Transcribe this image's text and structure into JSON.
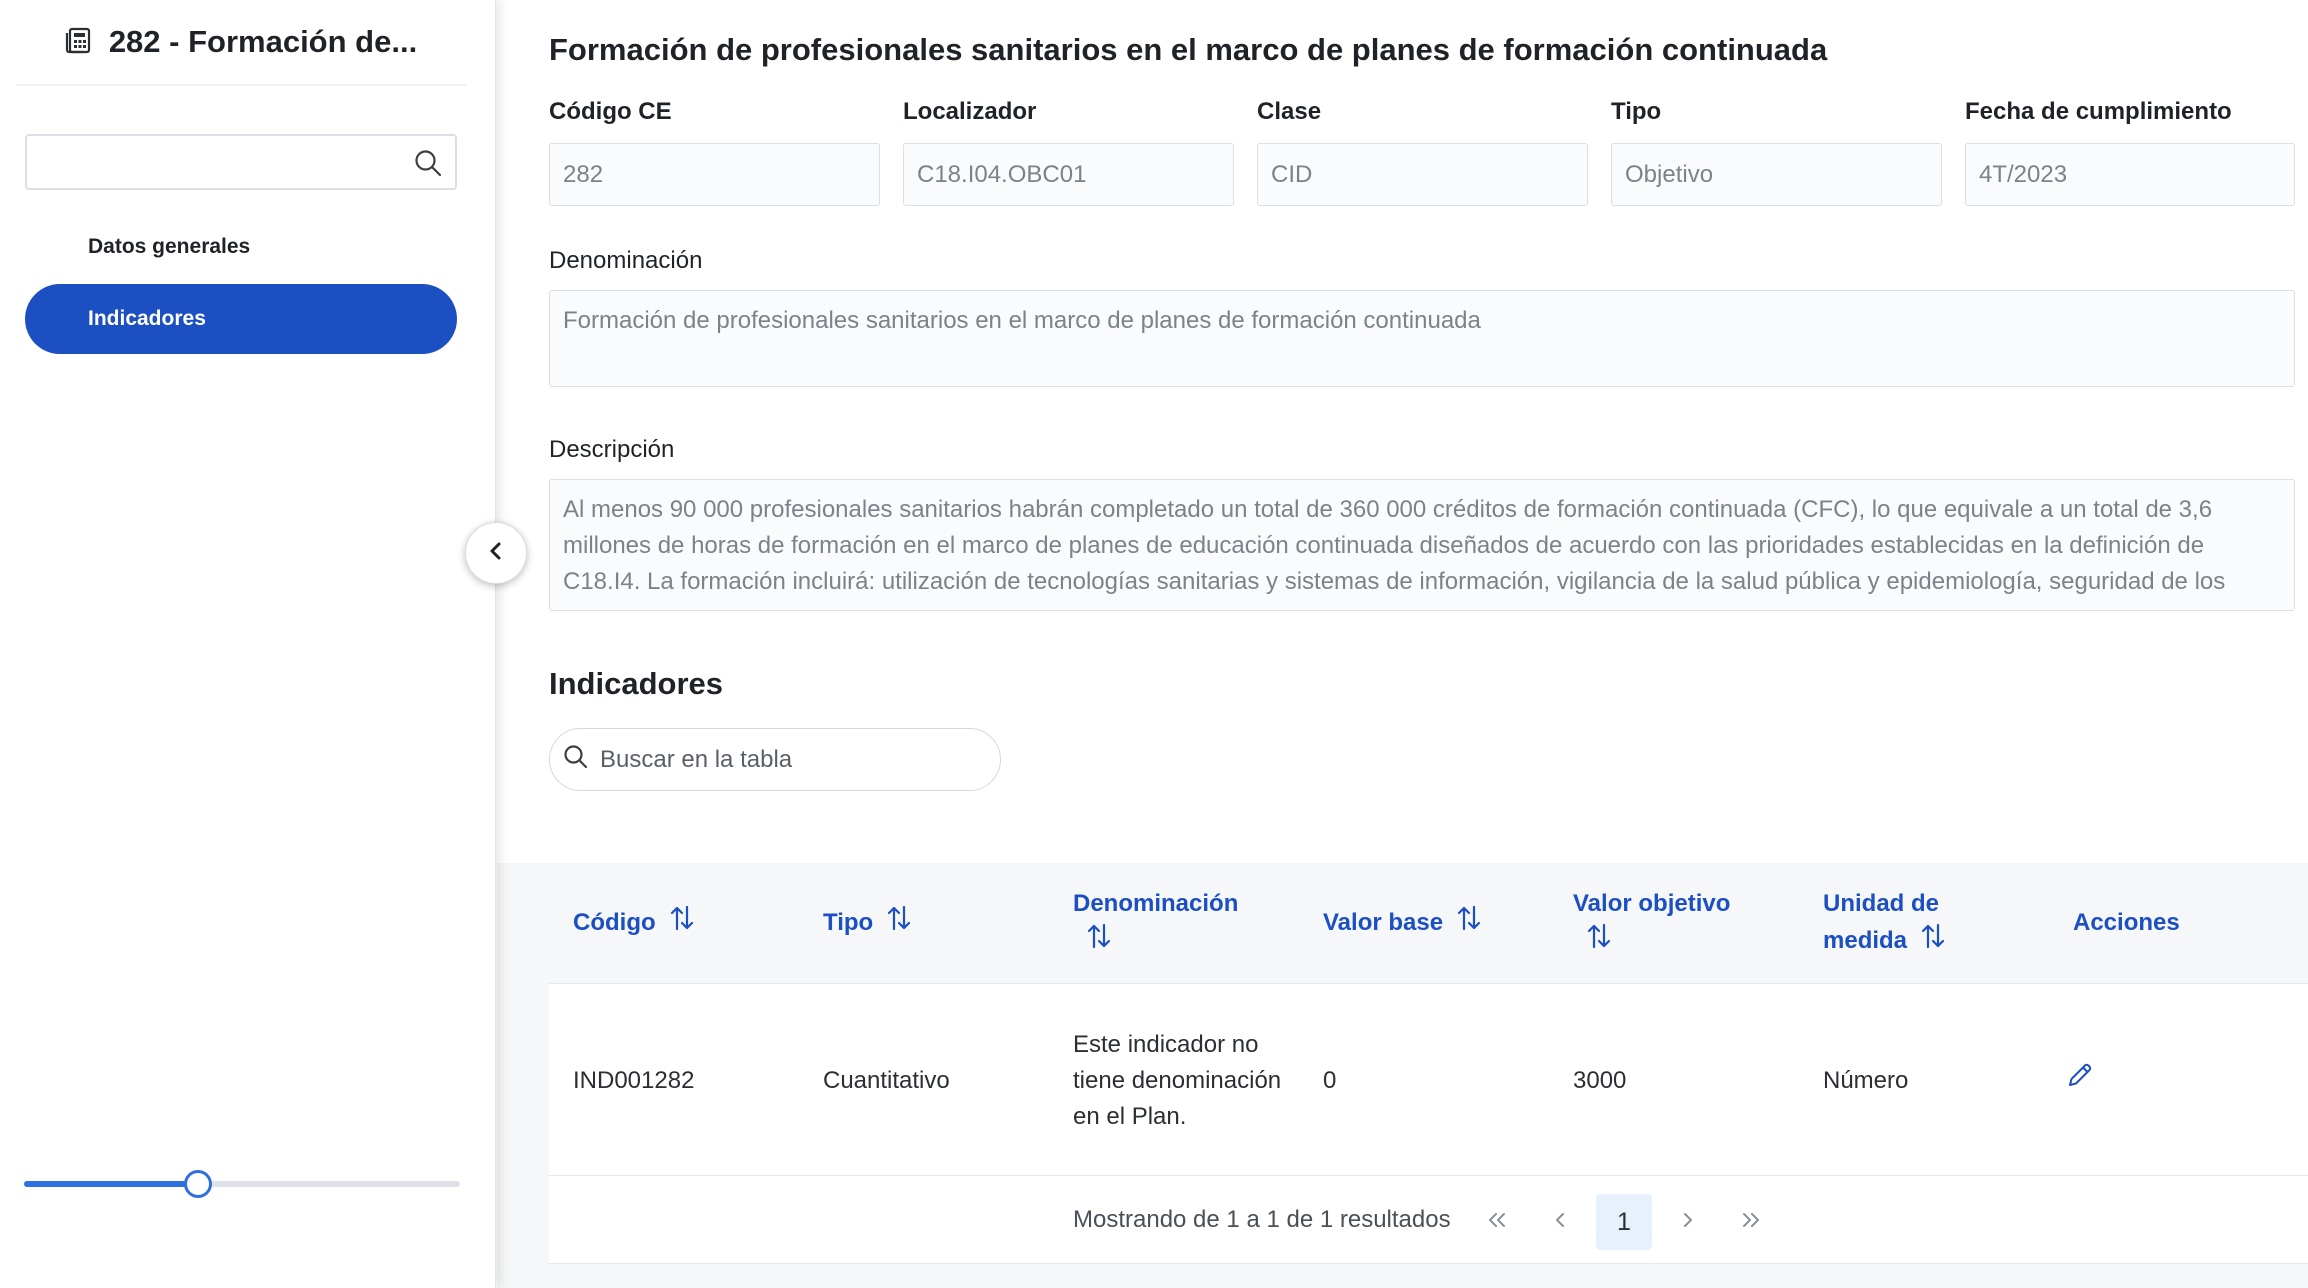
{
  "sidebar": {
    "title": "282 - Formación de...",
    "search_value": "",
    "items": [
      {
        "label": "Datos generales",
        "active": false
      },
      {
        "label": "Indicadores",
        "active": true
      }
    ],
    "zoom_slider_level": 0.4
  },
  "main": {
    "title": "Formación de profesionales sanitarios en el marco de planes de formación continuada",
    "fields": {
      "codigo_ce": {
        "label": "Código CE",
        "value": "282"
      },
      "localizador": {
        "label": "Localizador",
        "value": "C18.I04.OBC01"
      },
      "clase": {
        "label": "Clase",
        "value": "CID"
      },
      "tipo": {
        "label": "Tipo",
        "value": "Objetivo"
      },
      "fecha": {
        "label": "Fecha de cumplimiento",
        "value": "4T/2023"
      },
      "denominacion": {
        "label": "Denominación",
        "value": "Formación de profesionales sanitarios en el marco de planes de formación continuada"
      },
      "descripcion": {
        "label": "Descripción",
        "value": "Al menos 90 000 profesionales sanitarios habrán completado un total de 360 000 créditos de formación continuada (CFC), lo que equivale a un total de 3,6 millones de horas de formación en el marco de planes de educación continuada diseñados de acuerdo con las prioridades establecidas en la definición de C18.I4. La formación incluirá: utilización de tecnologías sanitarias y sistemas de información, vigilancia de la salud pública y epidemiología, seguridad de los"
      }
    }
  },
  "indicadores": {
    "section_title": "Indicadores",
    "search_placeholder": "Buscar en la tabla",
    "columns": {
      "codigo": "Código",
      "tipo": "Tipo",
      "denominacion": "Denominación",
      "valor_base": "Valor base",
      "valor_objetivo": "Valor objetivo",
      "unidad_a": "Unidad de",
      "unidad_b": "medida",
      "acciones": "Acciones"
    },
    "rows": [
      {
        "codigo": "IND001282",
        "tipo": "Cuantitativo",
        "denominacion": "Este indicador no tiene denominación en el Plan.",
        "valor_base": "0",
        "valor_objetivo": "3000",
        "unidad": "Número"
      }
    ],
    "pagination": {
      "summary": "Mostrando de 1 a 1 de 1 resultados",
      "current_page": "1"
    }
  },
  "colors": {
    "accent": "#1b4fc2",
    "slider": "#2f6fe0"
  }
}
